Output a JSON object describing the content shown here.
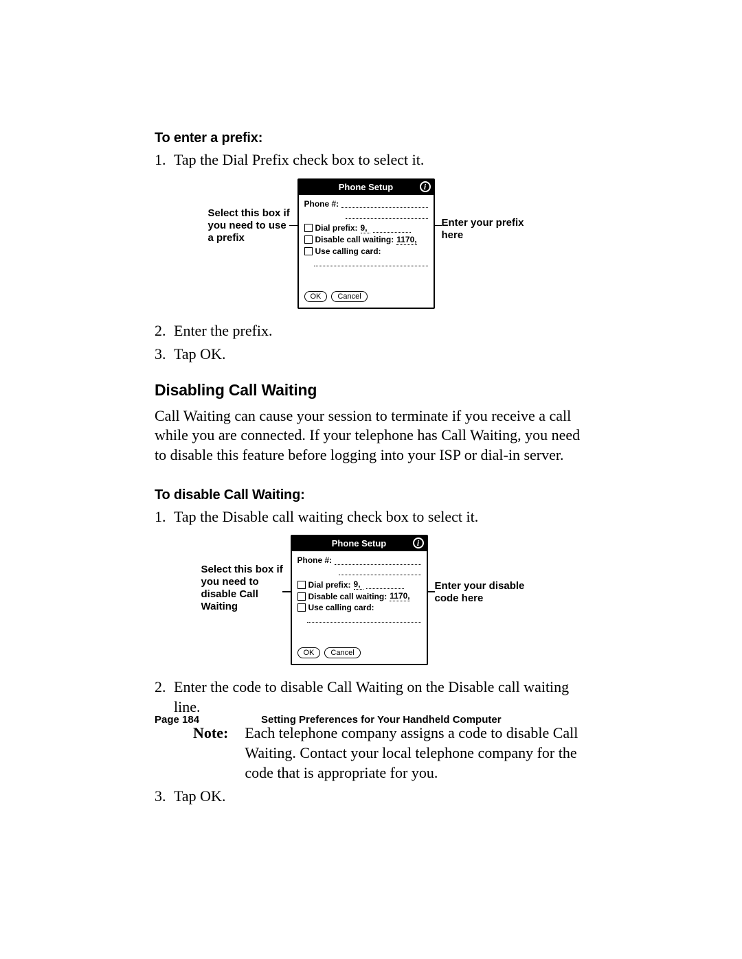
{
  "headings": {
    "to_enter_prefix": "To enter a prefix:",
    "disabling_call_waiting": "Disabling Call Waiting",
    "to_disable_call_waiting": "To disable Call Waiting:"
  },
  "prefix_steps": {
    "s1": "Tap the Dial Prefix check box to select it.",
    "s2": "Enter the prefix.",
    "s3": "Tap OK."
  },
  "call_waiting_intro": "Call Waiting can cause your session to terminate if you receive a call while you are connected. If your telephone has Call Waiting, you need to disable this feature before logging into your ISP or dial-in server.",
  "disable_steps": {
    "s1": "Tap the Disable call waiting check box to select it.",
    "s2": "Enter the code to disable Call Waiting on the Disable call waiting line.",
    "note_label": "Note:",
    "note_body": "Each telephone company assigns a code to disable Call Waiting. Contact your local telephone company for the code that is appropriate for you.",
    "s3": "Tap OK."
  },
  "device": {
    "title": "Phone Setup",
    "phone_label": "Phone #:",
    "dial_prefix_label": "Dial prefix:",
    "dial_prefix_value": "9,",
    "disable_cw_label": "Disable call waiting:",
    "disable_cw_value": "1170,",
    "use_calling_card_label": "Use calling card:",
    "ok": "OK",
    "cancel": "Cancel"
  },
  "callouts": {
    "fig1_left": "Select this box if you need to use a prefix",
    "fig1_right": "Enter your prefix here",
    "fig2_left": "Select this box if you need to disable Call Waiting",
    "fig2_right": "Enter your disable code here"
  },
  "footer": {
    "page": "Page 184",
    "chapter": "Setting Preferences for Your Handheld Computer"
  }
}
